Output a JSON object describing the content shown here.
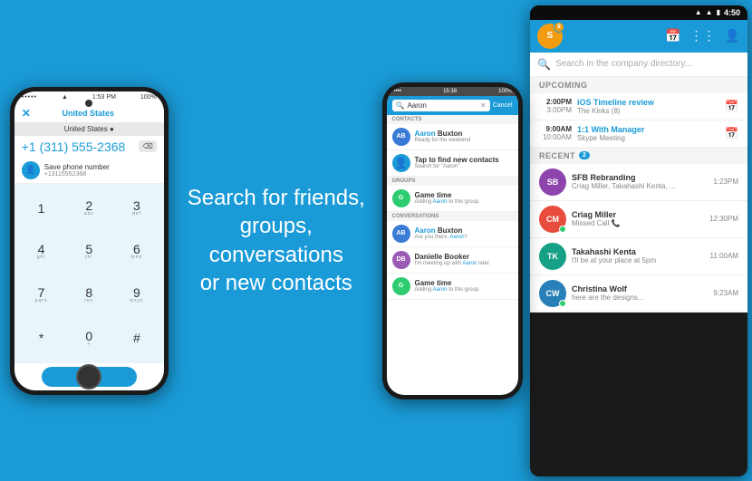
{
  "phone1": {
    "status": {
      "dots": "•••••",
      "wifi": "WiFi",
      "time": "1:53 PM",
      "battery": "100%"
    },
    "header": {
      "close": "✕",
      "title": "United States",
      "countryLabel": "United States ●"
    },
    "number": "+1 (311) 555-2368",
    "backspace": "⌫",
    "save": {
      "label": "Save phone number",
      "sub": "+13115552368"
    },
    "keys": [
      {
        "num": "1",
        "letters": ""
      },
      {
        "num": "2",
        "letters": "ABC"
      },
      {
        "num": "3",
        "letters": "DEF"
      },
      {
        "num": "4",
        "letters": "GHI"
      },
      {
        "num": "5",
        "letters": "JKL"
      },
      {
        "num": "6",
        "letters": "MNO"
      },
      {
        "num": "7",
        "letters": "PQRS"
      },
      {
        "num": "8",
        "letters": "TUV"
      },
      {
        "num": "9",
        "letters": "WXYZ"
      },
      {
        "num": "*",
        "letters": ""
      },
      {
        "num": "0",
        "letters": "+"
      },
      {
        "num": "#",
        "letters": ""
      }
    ],
    "callIcon": "📞"
  },
  "centerText": {
    "line1": "Search for friends,",
    "line2": "groups, conversations",
    "line3": "or new contacts"
  },
  "phone2": {
    "statusLeft": "•••••",
    "statusTime": "15:38",
    "statusRight": "100%",
    "searchValue": "Aaron",
    "cancelLabel": "Cancel",
    "sections": {
      "contacts": "Contacts",
      "groups": "Groups",
      "conversations": "Conversations"
    },
    "contacts": [
      {
        "name": "Aaron Buxton",
        "highlight": "Aaron",
        "sub": "Ready for the weekend",
        "color": "#3a7bd5"
      },
      {
        "name": "Tap to find new contacts",
        "sub": "Search for \"Aaron\"",
        "icon": "find"
      }
    ],
    "groups": [
      {
        "name": "Game time",
        "sub": "Adding Aaron to this group.",
        "color": "#2ecc71"
      }
    ],
    "conversations": [
      {
        "name": "Aaron Buxton",
        "sub": "Are you there, Aaron?",
        "color": "#3a7bd5"
      },
      {
        "name": "Danielle Booker",
        "sub": "I'm meeting up with Aaron later.",
        "color": "#9b59b6"
      },
      {
        "name": "Game time",
        "sub": "Adding Aaron to this group.",
        "color": "#2ecc71"
      }
    ]
  },
  "phone3": {
    "statusIcons": [
      "WiFi",
      "Signal",
      "Battery"
    ],
    "time": "4:50",
    "avatarInitial": "S",
    "badge": "8",
    "topIcons": [
      "calendar",
      "grid",
      "contacts"
    ],
    "search": {
      "placeholder": "Search in the company directory..."
    },
    "upcomingLabel": "UPCOMING",
    "recentLabel": "RECENT",
    "recentCount": "2",
    "events": [
      {
        "startTime": "2:00PM",
        "endTime": "3:00PM",
        "title": "iOS Timeline review",
        "sub": "The Kinks (8)"
      },
      {
        "startTime": "9:00AM",
        "endTime": "10:00AM",
        "title": "1:1 With Manager",
        "sub": "Skype Meeting"
      }
    ],
    "contacts": [
      {
        "initials": "SB",
        "color": "#8e44ad",
        "name": "SFB Rebranding",
        "sub": "Criag Miller, Takahashi Kenta, ...",
        "time": "1:23PM",
        "online": false
      },
      {
        "initials": "CM",
        "color": "#e74c3c",
        "name": "Criag Miller",
        "sub": "Missed Call 📞",
        "time": "12:30PM",
        "online": true
      },
      {
        "initials": "TK",
        "color": "#16a085",
        "name": "Takahashi Kenta",
        "sub": "I'll be at your place at 5pm",
        "time": "11:00AM",
        "online": false
      },
      {
        "initials": "CW",
        "color": "#2980b9",
        "name": "Christina Wolf",
        "sub": "here are the designs...",
        "time": "9:23AM",
        "online": true
      }
    ]
  }
}
